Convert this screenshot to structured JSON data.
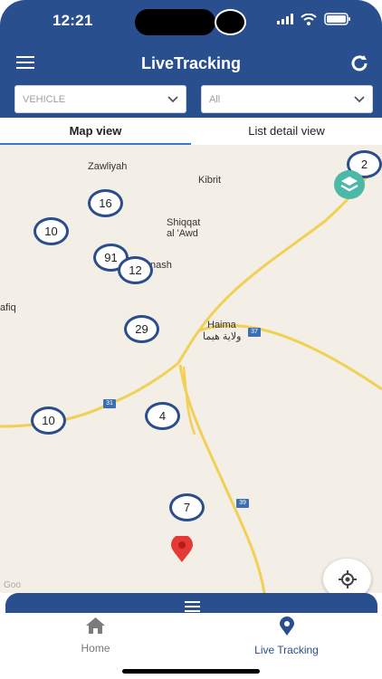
{
  "status_bar": {
    "time": "12:21"
  },
  "header": {
    "title": "LiveTracking",
    "menu_icon": "hamburger-menu-icon",
    "refresh_icon": "refresh-icon"
  },
  "filters": {
    "vehicle": "VEHICLE",
    "status": "All"
  },
  "tabs": [
    {
      "label": "Map view",
      "active": true
    },
    {
      "label": "List detail view",
      "active": false
    }
  ],
  "map": {
    "places": [
      "Zawliyah",
      "Kibrit",
      "Shiqqat",
      "al 'Awd",
      "nash",
      "afiq",
      "Haima",
      "ولاية هيما"
    ],
    "clusters": [
      "2",
      "16",
      "10",
      "91",
      "12",
      "29",
      "10",
      "4",
      "7"
    ],
    "road_numbers": [
      "37",
      "31",
      "39"
    ]
  },
  "bottom_nav": [
    {
      "label": "Home",
      "active": false,
      "icon": "home-icon"
    },
    {
      "label": "Live Tracking",
      "active": true,
      "icon": "location-pin-icon"
    }
  ],
  "colors": {
    "primary": "#294f8e",
    "active_nav": "#294f8e",
    "road": "#f2cf55",
    "marker": "#e53935"
  }
}
